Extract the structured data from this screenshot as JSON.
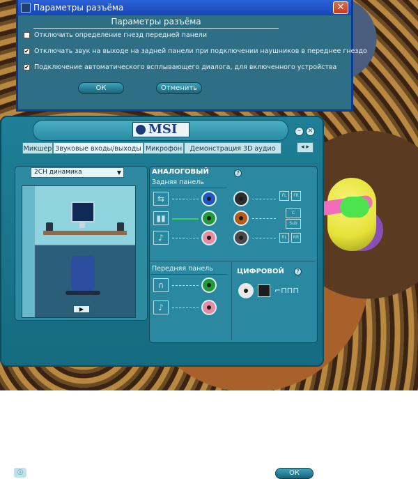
{
  "dialog": {
    "title": "Параметры разъёма",
    "header": "Параметры разъёма",
    "options": [
      {
        "label": "Отключить определение гнезд передней панели",
        "checked": false
      },
      {
        "label": "Отключать звук на выходе на задней панели при подключении наушников в переднее гнездо",
        "checked": true
      },
      {
        "label": "Подключение автоматического всплывающего диалога, для включенного устройства",
        "checked": true
      }
    ],
    "ok_label": "ОК",
    "cancel_label": "Отменить",
    "close_glyph": "✕"
  },
  "msi": {
    "logo_text": "MSI",
    "tabs": [
      "Микшер",
      "Звуковые входы/выходы",
      "Микрофон",
      "Демонстрация 3D аудио"
    ],
    "speaker_mode": "2CH динамика",
    "analog_label": "АНАЛОГОВЫЙ",
    "rear_panel_label": "Задняя панель",
    "front_panel_label": "Передняя панель",
    "digital_label": "ЦИФРОВОЙ",
    "ok_label": "ОК",
    "speaker_labels": {
      "fl": "FL",
      "fr": "FR",
      "c": "C",
      "sub": "Sub",
      "rl": "RL",
      "rr": "RR"
    },
    "jack_colors": {
      "blue": "#1f57c4",
      "green": "#1f9a3a",
      "pink": "#e48aa2",
      "black": "#2e2e2e",
      "orange": "#b55a1a",
      "gray": "#4a4a4a"
    }
  }
}
